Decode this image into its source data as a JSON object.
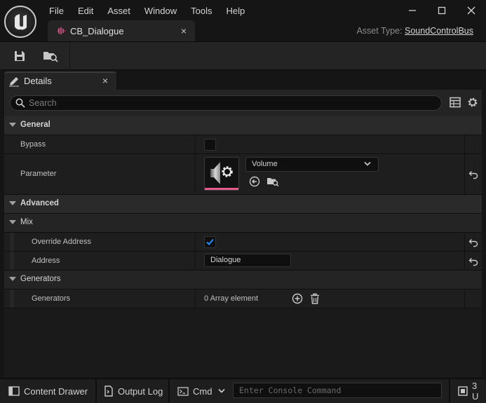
{
  "menu": [
    "File",
    "Edit",
    "Asset",
    "Window",
    "Tools",
    "Help"
  ],
  "window_controls": {
    "minimize": "minimize-icon",
    "maximize": "maximize-icon",
    "close": "close-icon"
  },
  "doc_tab": {
    "label": "CB_Dialogue",
    "close": "×",
    "icon": "sound-control-bus-icon"
  },
  "asset_type": {
    "label": "Asset Type:",
    "value": "SoundControlBus"
  },
  "toolbar": {
    "save_icon": "save-icon",
    "browse_icon": "browse-to-asset-icon"
  },
  "details": {
    "tab_label": "Details",
    "tab_close": "×",
    "search_placeholder": "Search",
    "categories": {
      "general": "General",
      "advanced": "Advanced",
      "mix": "Mix",
      "generators": "Generators"
    },
    "props": {
      "bypass": {
        "label": "Bypass",
        "checked": false
      },
      "parameter": {
        "label": "Parameter",
        "value": "Volume"
      },
      "override_address": {
        "label": "Override Address",
        "checked": true
      },
      "address": {
        "label": "Address",
        "value": "Dialogue"
      },
      "generators": {
        "label": "Generators",
        "value": "0 Array element"
      }
    }
  },
  "statusbar": {
    "content_drawer": "Content Drawer",
    "output_log": "Output Log",
    "cmd": "Cmd",
    "console_placeholder": "Enter Console Command",
    "source_control": "3 U"
  },
  "colors": {
    "accent_pink": "#e35a8f",
    "check_blue": "#1e90ff"
  }
}
